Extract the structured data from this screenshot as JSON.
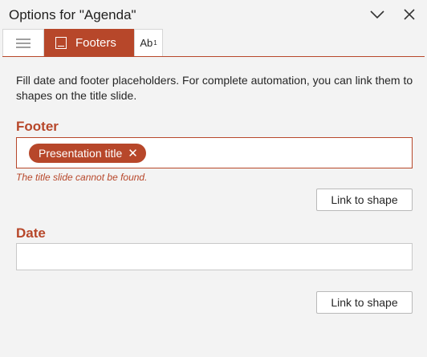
{
  "pane": {
    "title": "Options for \"Agenda\""
  },
  "tabs": {
    "menu_icon": "hamburger-icon",
    "active_label": "Footers",
    "active_icon": "footer-icon",
    "third_label": "Ab",
    "third_superscript": "1"
  },
  "main": {
    "intro": "Fill date and footer placeholders. For complete automation, you can link them to shapes on the title slide.",
    "footer": {
      "label": "Footer",
      "chip_label": "Presentation title",
      "chip_remove": "✕",
      "error": "The title slide cannot be found.",
      "link_button": "Link to shape"
    },
    "date": {
      "label": "Date",
      "value": "",
      "link_button": "Link to shape"
    }
  },
  "colors": {
    "accent": "#b7472a",
    "background": "#f3f3f3"
  }
}
